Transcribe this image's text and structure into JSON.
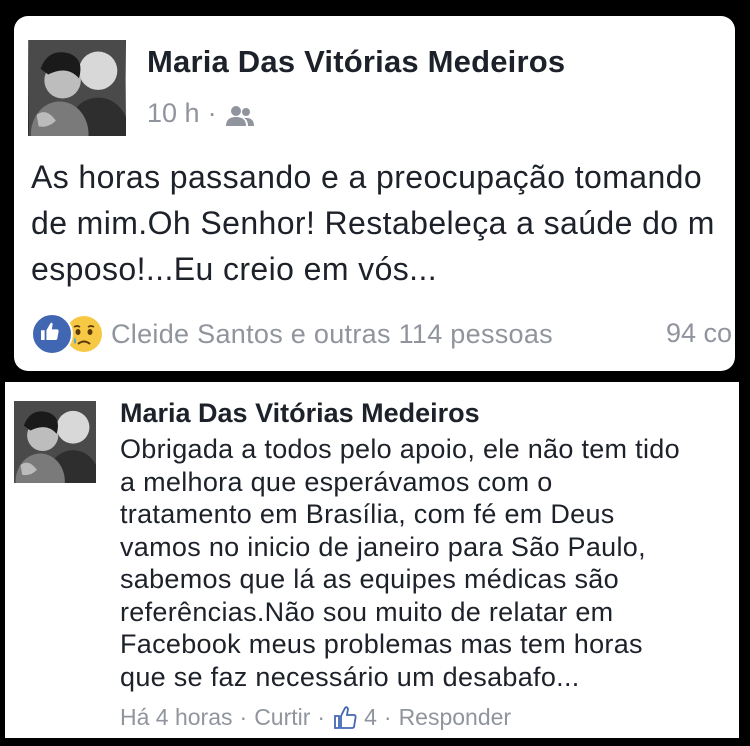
{
  "post": {
    "author": "Maria Das Vitórias Medeiros",
    "time": "10 h",
    "separator": "·",
    "audience_icon": "friends-icon",
    "body_lines": [
      "As horas passando e a preocupação tomando",
      "de mim.Oh Senhor! Restabeleça a saúde do m",
      "esposo!...Eu creio em  vós..."
    ],
    "reactions": {
      "icons": [
        "like-icon",
        "sad-icon"
      ],
      "text": "Cleide Santos e outras 114 pessoas"
    },
    "comments_count": "94 co"
  },
  "comment": {
    "author": "Maria Das Vitórias Medeiros",
    "body_lines": [
      "Obrigada a todos pelo apoio, ele não tem tido",
      "a melhora que esperávamos  com o",
      "tratamento em Brasília, com fé em Deus",
      "vamos no inicio de janeiro para São Paulo,",
      "sabemos que lá as equipes médicas são",
      "referências.Não sou muito de relatar em",
      "Facebook meus problemas mas tem horas",
      "que se faz necessário um desabafo..."
    ],
    "actions": {
      "time": "Há 4 horas",
      "separator": "·",
      "like": "Curtir",
      "like_count": "4",
      "reply": "Responder"
    }
  },
  "colors": {
    "like_blue": "#4267b2",
    "meta_gray": "#90949c",
    "text": "#1d2129"
  }
}
